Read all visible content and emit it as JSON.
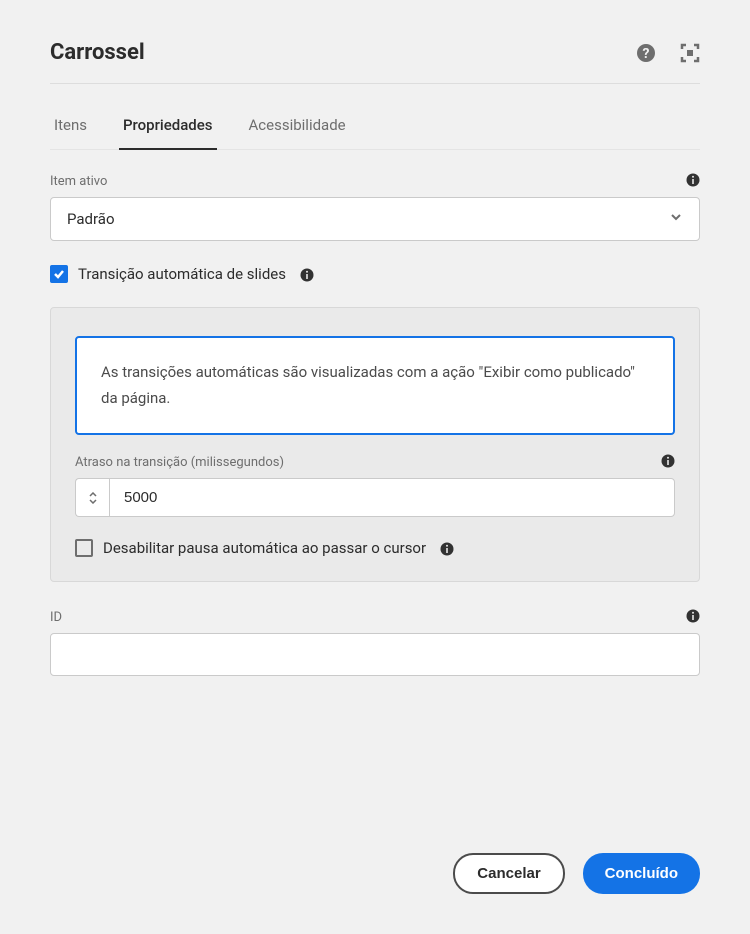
{
  "header": {
    "title": "Carrossel"
  },
  "tabs": {
    "items": [
      {
        "label": "Itens"
      },
      {
        "label": "Propriedades"
      },
      {
        "label": "Acessibilidade"
      }
    ]
  },
  "activeItem": {
    "label": "Item ativo",
    "value": "Padrão"
  },
  "autoTransition": {
    "label": "Transição automática de slides",
    "calloutText": "As transições automáticas são visualizadas com a ação \"Exibir como publicado\" da página.",
    "delayLabel": "Atraso na transição (milissegundos)",
    "delayValue": "5000",
    "disablePauseLabel": "Desabilitar pausa automática ao passar o cursor"
  },
  "idField": {
    "label": "ID",
    "value": ""
  },
  "footer": {
    "cancel": "Cancelar",
    "done": "Concluído"
  }
}
